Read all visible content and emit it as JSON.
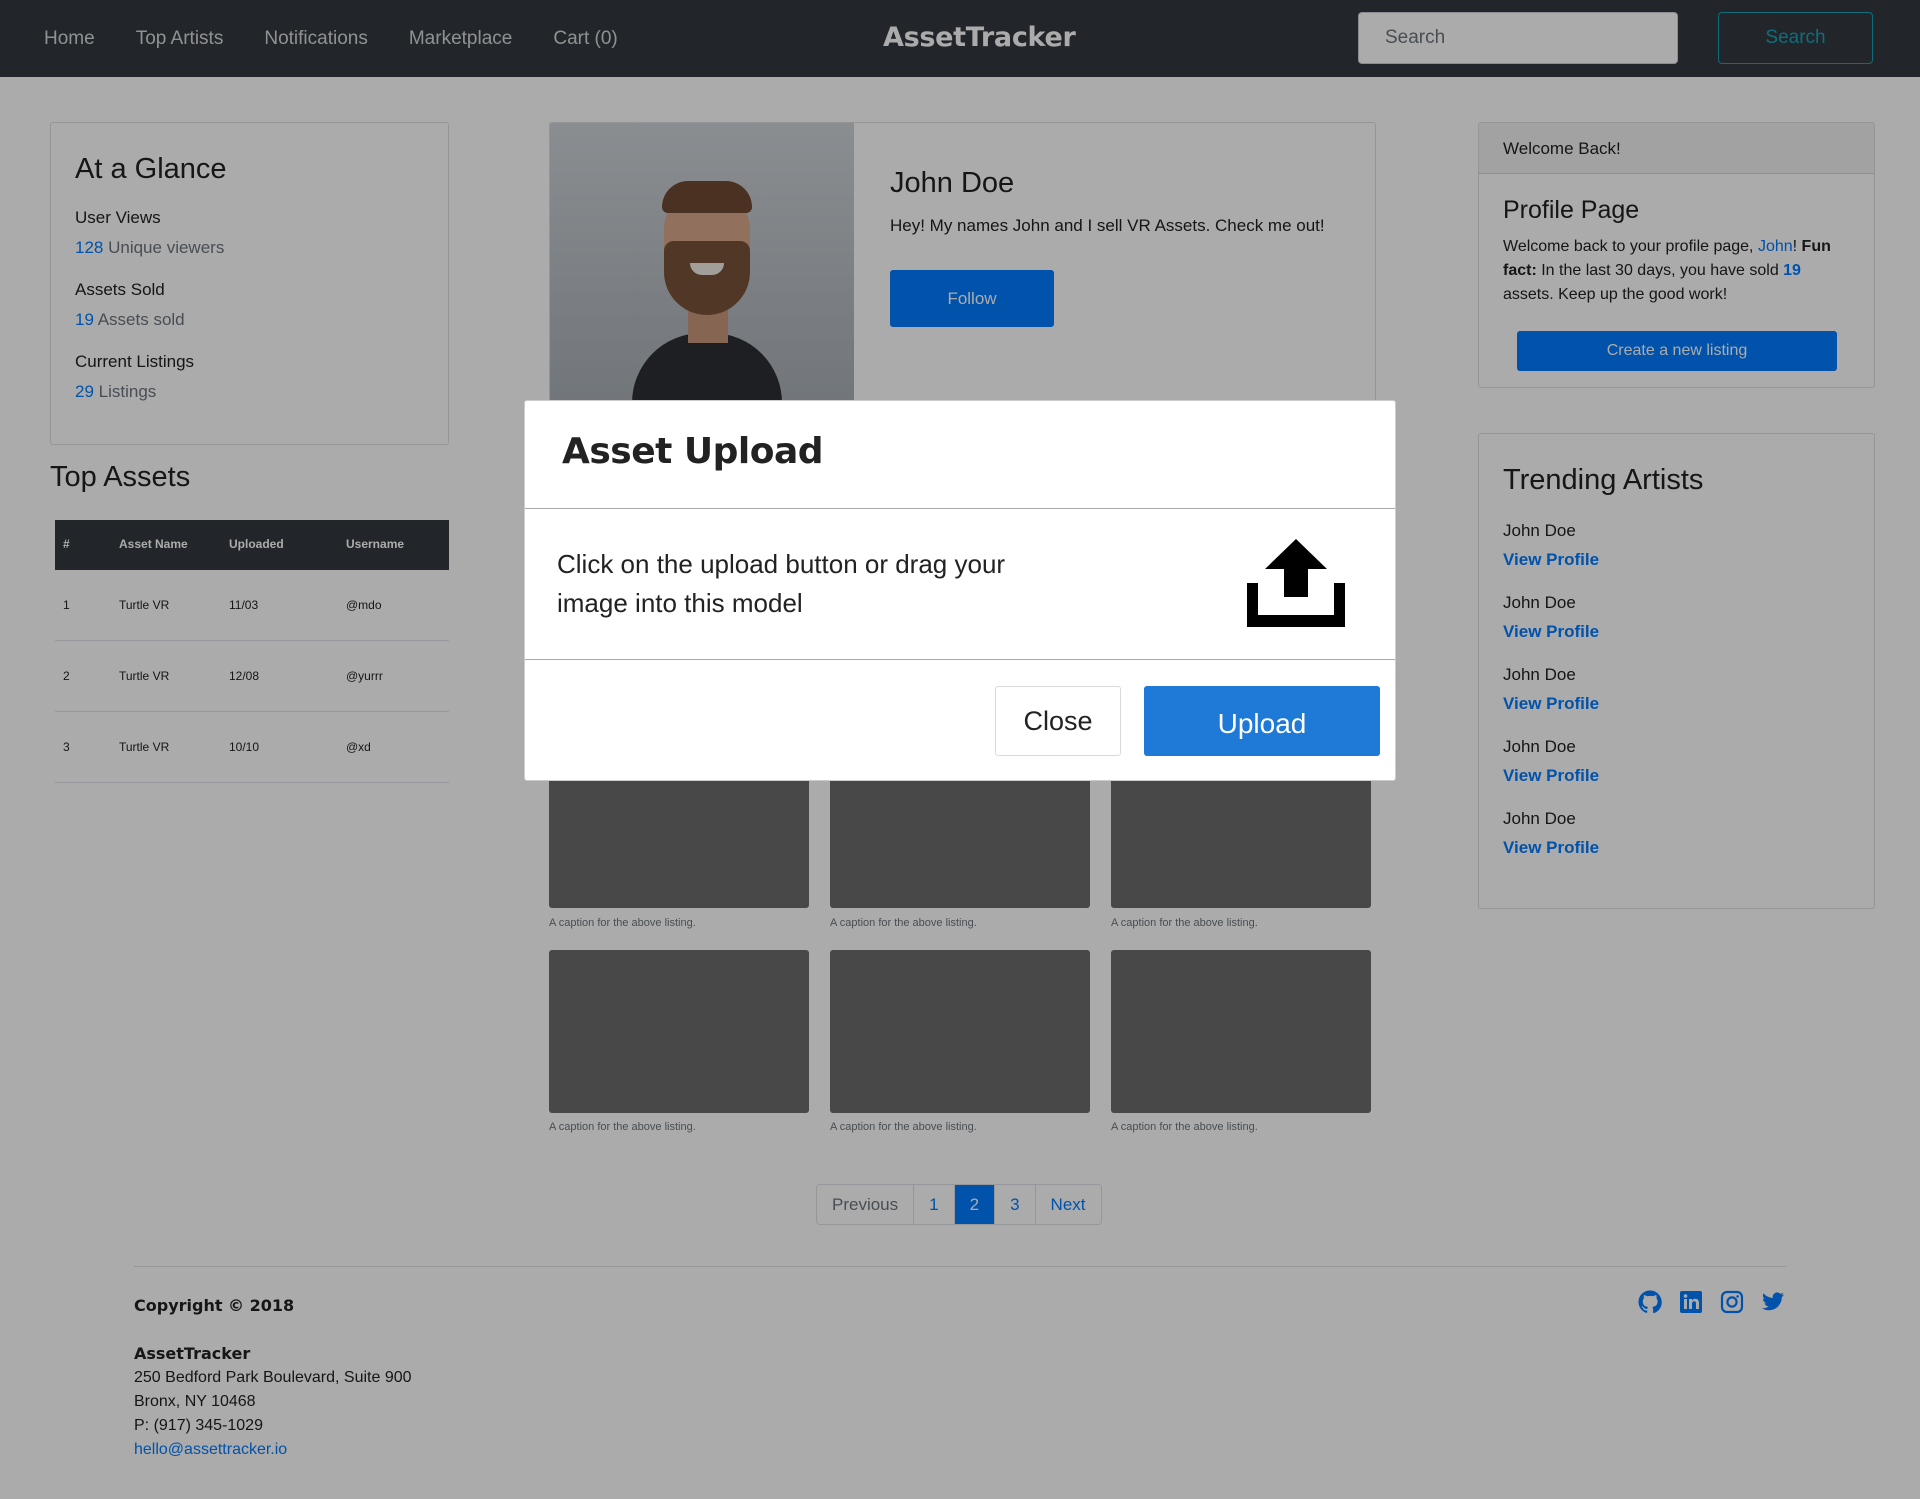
{
  "navbar": {
    "links": [
      "Home",
      "Top Artists",
      "Notifications",
      "Marketplace",
      "Cart (0)"
    ],
    "brand": "AssetTracker",
    "search_placeholder": "Search",
    "search_button": "Search"
  },
  "glance": {
    "title": "At a Glance",
    "user_views_label": "User Views",
    "user_views_value": "128",
    "user_views_suffix": " Unique viewers",
    "assets_sold_label": "Assets Sold",
    "assets_sold_value": "19",
    "assets_sold_suffix": " Assets sold",
    "listings_label": "Current Listings",
    "listings_value": "29",
    "listings_suffix": " Listings"
  },
  "top_assets": {
    "title": "Top Assets",
    "headers": [
      "#",
      "Asset Name",
      "Uploaded",
      "Username"
    ],
    "rows": [
      [
        "1",
        "Turtle VR",
        "11/03",
        "@mdo"
      ],
      [
        "2",
        "Turtle VR",
        "12/08",
        "@yurrr"
      ],
      [
        "3",
        "Turtle VR",
        "10/10",
        "@xd"
      ]
    ]
  },
  "profile": {
    "name": "John Doe",
    "bio": "Hey! My names John and I sell VR Assets. Check me out!",
    "follow_button": "Follow"
  },
  "listings": {
    "caption": "A caption for the above listing."
  },
  "pagination": {
    "previous": "Previous",
    "pages": [
      "1",
      "2",
      "3"
    ],
    "active_page": "2",
    "next": "Next"
  },
  "welcome": {
    "header": "Welcome Back!",
    "title": "Profile Page",
    "text_1": "Welcome back to your profile page, ",
    "name_link": "John",
    "text_2": "! ",
    "fun_fact": "Fun fact:",
    "text_3": " In the last 30 days, you have sold ",
    "sold_count": "19",
    "text_4": " assets. Keep up the good work!",
    "create_button": "Create a new listing"
  },
  "trending": {
    "title": "Trending Artists",
    "artists": [
      {
        "name": "John Doe",
        "link": "View Profile"
      },
      {
        "name": "John Doe",
        "link": "View Profile"
      },
      {
        "name": "John Doe",
        "link": "View Profile"
      },
      {
        "name": "John Doe",
        "link": "View Profile"
      },
      {
        "name": "John Doe",
        "link": "View Profile"
      }
    ]
  },
  "footer": {
    "copyright": "Copyright © 2018",
    "company": "AssetTracker",
    "address_1": "250 Bedford Park Boulevard, Suite 900",
    "address_2": "Bronx, NY 10468",
    "phone": "P: (917) 345-1029",
    "email": "hello@assettracker.io",
    "social_icons": [
      "github-icon",
      "linkedin-icon",
      "instagram-icon",
      "twitter-icon"
    ]
  },
  "modal": {
    "title": "Asset Upload",
    "body": "Click on the upload button or drag your image into this model",
    "close_button": "Close",
    "upload_button": "Upload"
  },
  "colors": {
    "navbar": "#343a40",
    "primary": "#007bff",
    "upload_button": "#1e7ad6",
    "search_outline": "#17a2b8"
  }
}
